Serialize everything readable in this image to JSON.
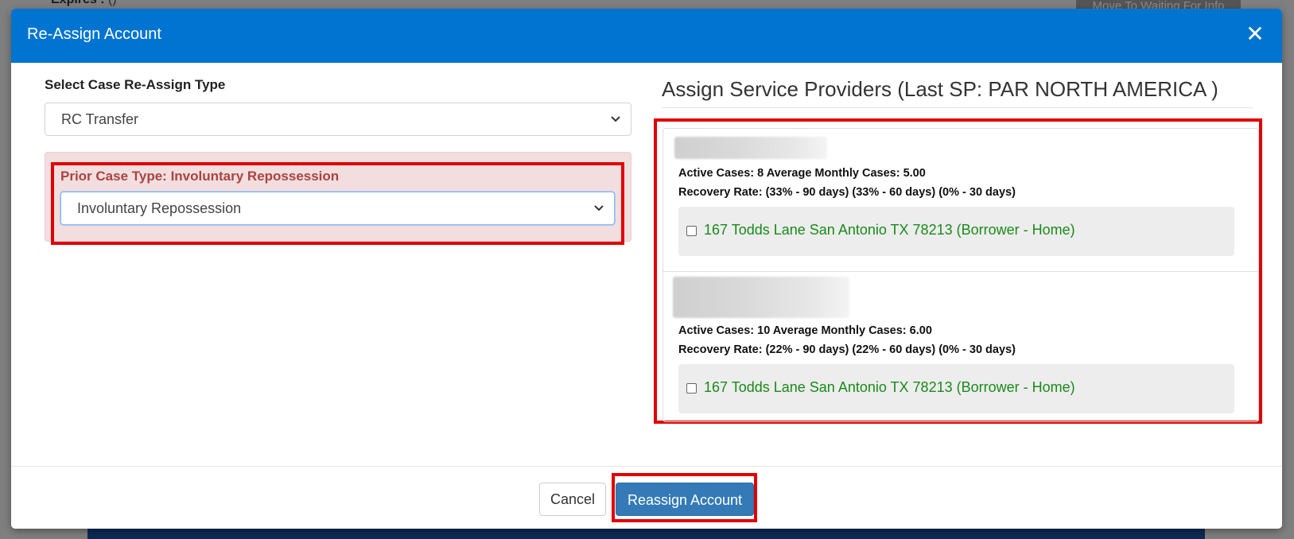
{
  "background": {
    "expires_label": "Expires :",
    "expires_value": "()",
    "move_button_label": "Move To Waiting For Info"
  },
  "modal": {
    "title": "Re-Assign Account",
    "close_icon": "close-icon"
  },
  "reassign_type": {
    "label": "Select Case Re-Assign Type",
    "selected": "RC Transfer"
  },
  "prior_case": {
    "label": "Prior Case Type: Involuntary Repossession",
    "selected": "Involuntary Repossession"
  },
  "service_providers": {
    "title": "Assign Service Providers (Last SP: PAR NORTH AMERICA )",
    "items": [
      {
        "stats": "Active Cases: 8 Average Monthly Cases: 5.00",
        "recovery": "Recovery Rate: (33% - 90 days) (33% - 60 days) (0% - 30 days)",
        "address": "167 Todds Lane San Antonio TX 78213 (Borrower - Home)",
        "checked": false
      },
      {
        "stats": "Active Cases: 10 Average Monthly Cases: 6.00",
        "recovery": "Recovery Rate: (22% - 90 days) (22% - 60 days) (0% - 30 days)",
        "address": "167 Todds Lane San Antonio TX 78213 (Borrower - Home)",
        "checked": false
      }
    ]
  },
  "footer": {
    "cancel_label": "Cancel",
    "reassign_label": "Reassign Account"
  },
  "colors": {
    "header": "#0174d2",
    "highlight": "#e00000",
    "address_text": "#1a8a1a",
    "primary_button": "#337ab7",
    "alert_text": "#a94442"
  }
}
